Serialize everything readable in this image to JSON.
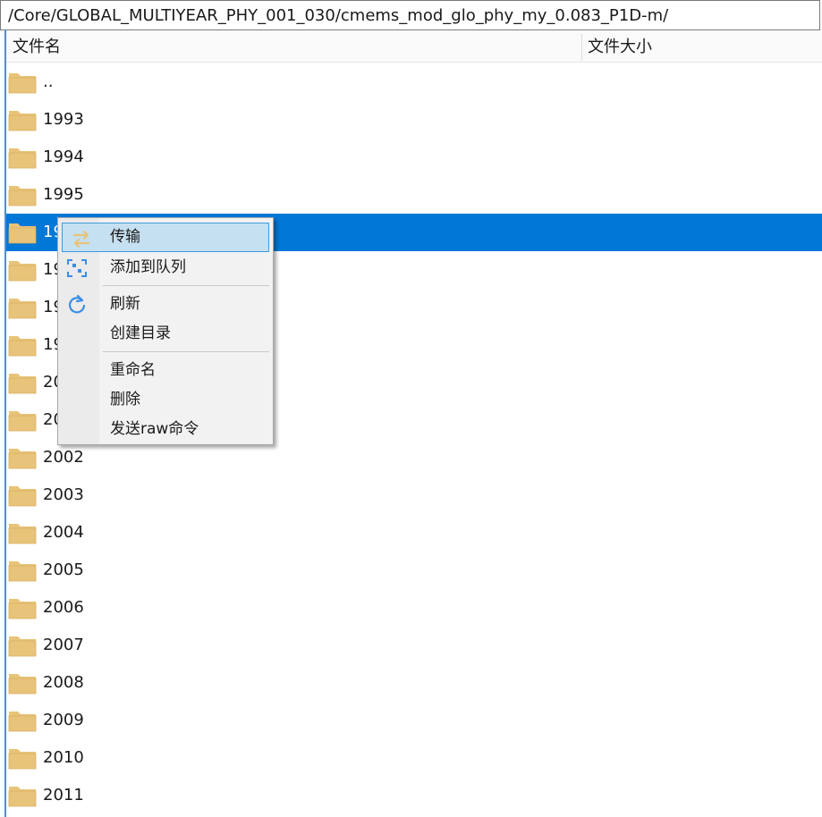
{
  "path": {
    "value": "/Core/GLOBAL_MULTIYEAR_PHY_001_030/cmems_mod_glo_phy_my_0.083_P1D-m/"
  },
  "columns": {
    "name": "文件名",
    "size": "文件大小"
  },
  "files": [
    {
      "name": ".."
    },
    {
      "name": "1993"
    },
    {
      "name": "1994"
    },
    {
      "name": "1995"
    },
    {
      "name": "1996"
    },
    {
      "name": "1997"
    },
    {
      "name": "1998"
    },
    {
      "name": "1999"
    },
    {
      "name": "2000"
    },
    {
      "name": "2001"
    },
    {
      "name": "2002"
    },
    {
      "name": "2003"
    },
    {
      "name": "2004"
    },
    {
      "name": "2005"
    },
    {
      "name": "2006"
    },
    {
      "name": "2007"
    },
    {
      "name": "2008"
    },
    {
      "name": "2009"
    },
    {
      "name": "2010"
    },
    {
      "name": "2011"
    }
  ],
  "context_menu": {
    "transfer": "传输",
    "add_to_queue": "添加到队列",
    "refresh": "刷新",
    "create_directory": "创建目录",
    "rename": "重命名",
    "delete": "删除",
    "send_raw": "发送raw命令"
  },
  "colors": {
    "selection": "#0078d7",
    "folder": "#e8c47a",
    "menu_highlight": "#c5e0f0",
    "accent_icon": "#3a8ee6"
  }
}
